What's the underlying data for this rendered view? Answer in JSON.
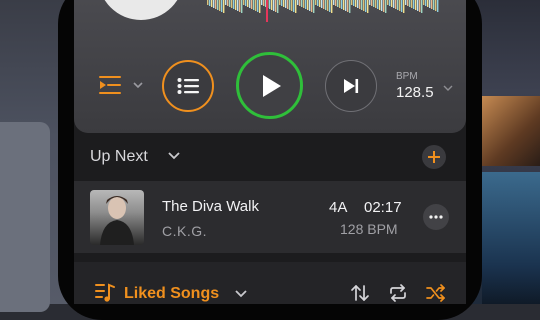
{
  "player": {
    "bpm_label": "BPM",
    "bpm_value": "128.5",
    "accent_color": "#f0901e",
    "play_color": "#2fbf3a"
  },
  "up_next": {
    "title": "Up Next",
    "tracks": [
      {
        "title": "The Diva Walk",
        "artist": "C.K.G.",
        "key": "4A",
        "duration": "02:17",
        "bpm": "128 BPM"
      }
    ]
  },
  "bottom_bar": {
    "playlist_name": "Liked Songs"
  },
  "icons": [
    "queue-icon",
    "chevron-down-icon",
    "list-icon",
    "play-icon",
    "skip-next-icon",
    "plus-icon",
    "more-icon",
    "playlist-icon",
    "sort-icon",
    "repeat-icon",
    "shuffle-icon"
  ]
}
